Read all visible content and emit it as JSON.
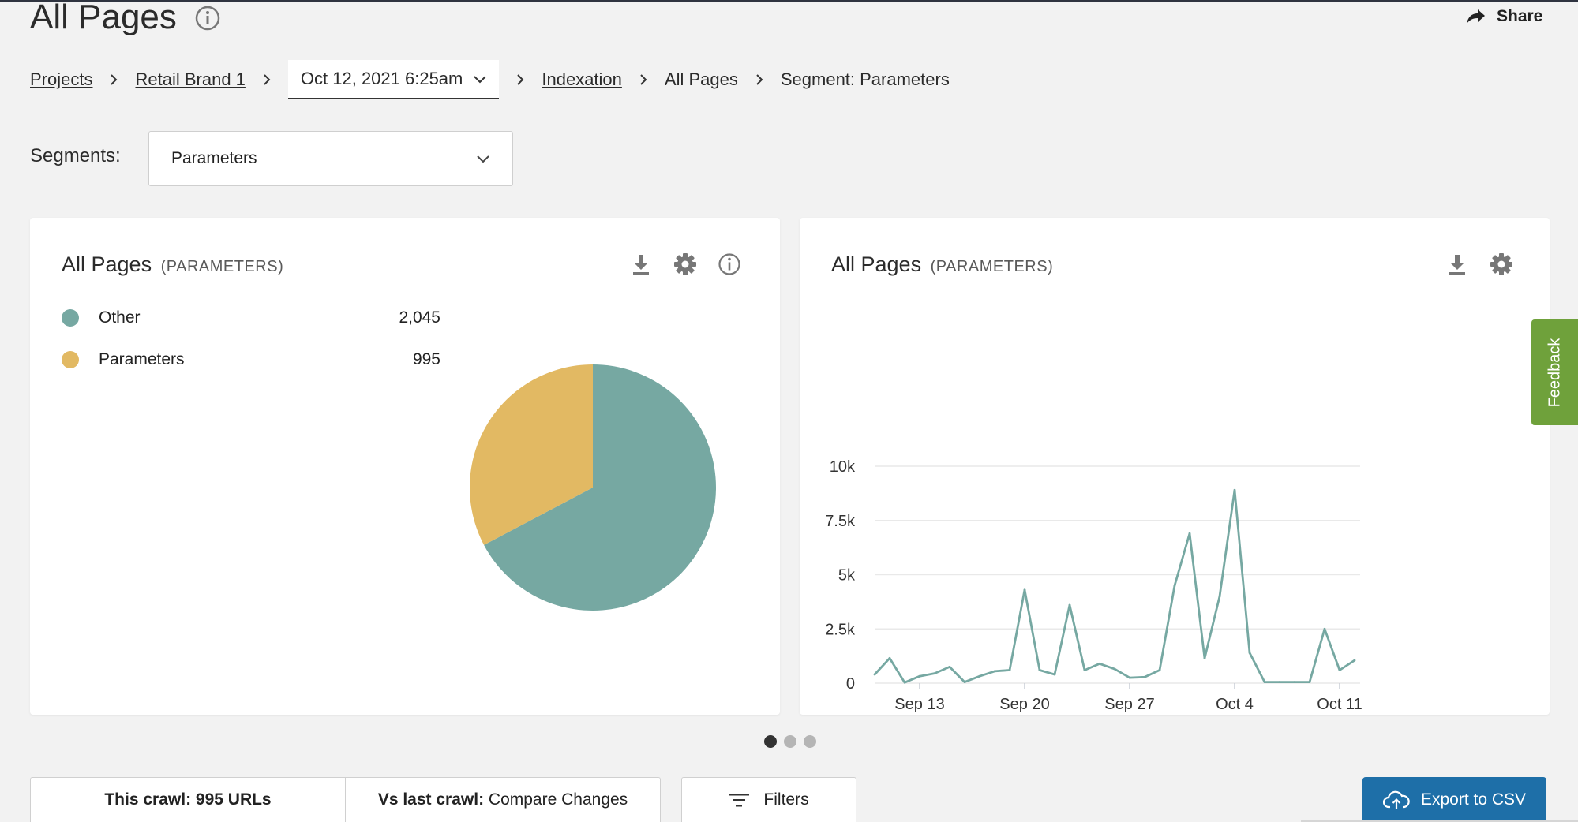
{
  "header": {
    "title": "All Pages",
    "share_label": "Share"
  },
  "breadcrumb": {
    "projects": "Projects",
    "project": "Retail Brand 1",
    "crawl_date": "Oct 12, 2021 6:25am",
    "indexation": "Indexation",
    "all_pages": "All Pages",
    "segment": "Segment: Parameters"
  },
  "segments": {
    "label": "Segments:",
    "selected": "Parameters"
  },
  "pie_card": {
    "title": "All Pages",
    "subtitle": "(PARAMETERS)",
    "legend": [
      {
        "name": "Other",
        "value": "2,045",
        "color": "#76a8a2"
      },
      {
        "name": "Parameters",
        "value": "995",
        "color": "#e2b963"
      }
    ]
  },
  "line_card": {
    "title": "All Pages",
    "subtitle": "(PARAMETERS)"
  },
  "chart_data": [
    {
      "type": "pie",
      "labels": [
        "Other",
        "Parameters"
      ],
      "values": [
        2045,
        995
      ],
      "colors": [
        "#76a8a2",
        "#e2b963"
      ]
    },
    {
      "type": "line",
      "x": [
        "Sep 10",
        "Sep 11",
        "Sep 12",
        "Sep 13",
        "Sep 14",
        "Sep 15",
        "Sep 16",
        "Sep 17",
        "Sep 18",
        "Sep 19",
        "Sep 20",
        "Sep 21",
        "Sep 22",
        "Sep 23",
        "Sep 24",
        "Sep 25",
        "Sep 26",
        "Sep 27",
        "Sep 28",
        "Sep 29",
        "Sep 30",
        "Oct 1",
        "Oct 2",
        "Oct 3",
        "Oct 4",
        "Oct 5",
        "Oct 6",
        "Oct 7",
        "Oct 8",
        "Oct 9",
        "Oct 10",
        "Oct 11",
        "Oct 12"
      ],
      "x_ticks": [
        "Sep 13",
        "Sep 20",
        "Sep 27",
        "Oct 4",
        "Oct 11"
      ],
      "y_ticks": [
        "0",
        "2.5k",
        "5k",
        "7.5k",
        "10k"
      ],
      "ylim": [
        0,
        10000
      ],
      "grid": true,
      "legend_position": "bottom",
      "series": [
        {
          "name": "All Pages",
          "color": "#76a8a2",
          "values": [
            [
              0,
              400
            ],
            [
              1,
              1150
            ],
            [
              2,
              30
            ],
            [
              3,
              320
            ],
            [
              4,
              450
            ],
            [
              5,
              750
            ],
            [
              6,
              50
            ],
            [
              7,
              320
            ],
            [
              8,
              550
            ],
            [
              9,
              600
            ],
            [
              10,
              4300
            ],
            [
              11,
              600
            ],
            [
              12,
              400
            ],
            [
              13,
              3600
            ],
            [
              14,
              600
            ],
            [
              15,
              900
            ],
            [
              16,
              650
            ],
            [
              17,
              250
            ],
            [
              18,
              280
            ],
            [
              19,
              600
            ],
            [
              20,
              4500
            ],
            [
              21,
              6900
            ],
            [
              22,
              1150
            ],
            [
              23,
              4000
            ],
            [
              24,
              8900
            ],
            [
              25,
              1400
            ],
            [
              26,
              50
            ],
            [
              27,
              50
            ],
            [
              28,
              50
            ],
            [
              29,
              50
            ],
            [
              30,
              2500
            ],
            [
              31,
              600
            ],
            [
              32,
              1050
            ]
          ]
        }
      ]
    }
  ],
  "carousel": {
    "pages": 3,
    "active": 0
  },
  "footer": {
    "this_crawl_label": "This crawl:",
    "this_crawl_value": "995 URLs",
    "vs_last_label": "Vs last crawl:",
    "vs_last_value": "Compare Changes",
    "filters_label": "Filters",
    "export_label": "Export to CSV"
  },
  "feedback_label": "Feedback"
}
